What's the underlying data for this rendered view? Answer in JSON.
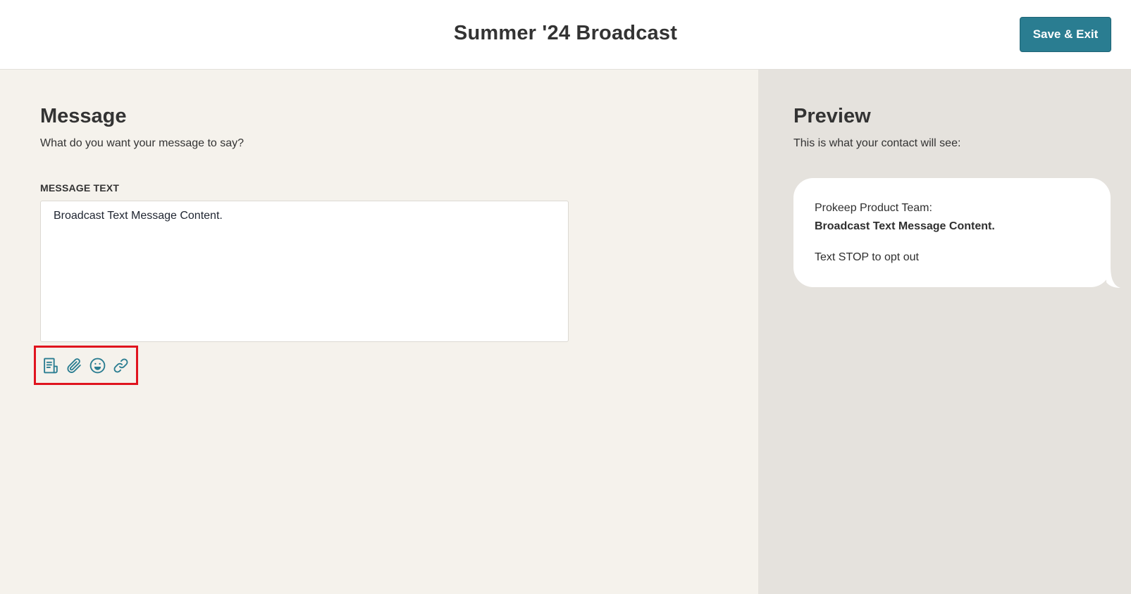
{
  "header": {
    "title": "Summer '24 Broadcast",
    "save_label": "Save & Exit"
  },
  "message": {
    "title": "Message",
    "subtitle": "What do you want your message to say?",
    "field_label": "MESSAGE TEXT",
    "text": "Broadcast Text Message Content.",
    "toolbar_icons": [
      "template-icon",
      "attachment-icon",
      "emoji-icon",
      "link-icon"
    ]
  },
  "preview": {
    "title": "Preview",
    "subtitle": "This is what your contact will see:",
    "sender": "Prokeep Product Team:",
    "body": "Broadcast Text Message Content.",
    "opt_out": "Text STOP to opt out"
  },
  "colors": {
    "accent": "#2a7d91",
    "left_bg": "#f5f2ec",
    "right_bg": "#e5e2dd",
    "highlight": "#e0141e"
  }
}
